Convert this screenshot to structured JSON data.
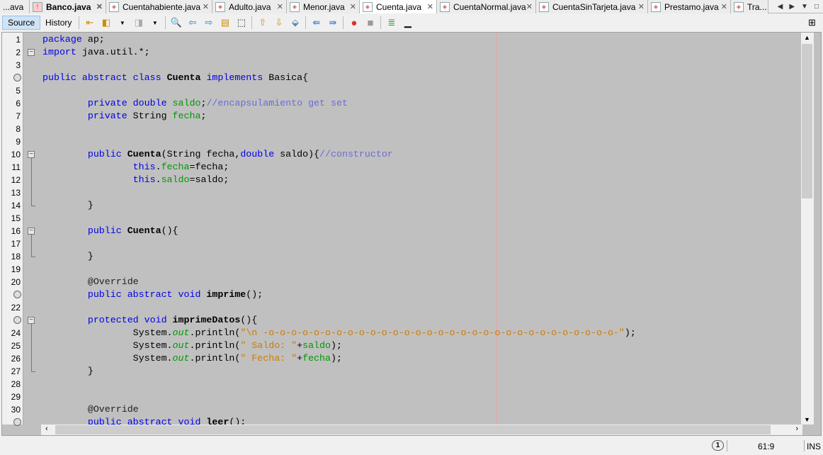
{
  "tabs": [
    {
      "label": "...ava",
      "active": false,
      "bold": false
    },
    {
      "label": "Banco.java",
      "active": false,
      "bold": true,
      "error": true
    },
    {
      "label": "Cuentahabiente.java",
      "active": false
    },
    {
      "label": "Adulto.java",
      "active": false
    },
    {
      "label": "Menor.java",
      "active": false
    },
    {
      "label": "Cuenta.java",
      "active": true
    },
    {
      "label": "CuentaNormal.java",
      "active": false
    },
    {
      "label": "CuentaSinTarjeta.java",
      "active": false
    },
    {
      "label": "Prestamo.java",
      "active": false
    },
    {
      "label": "Tra...",
      "active": false,
      "noclose": true
    }
  ],
  "toolbar": {
    "source_label": "Source",
    "history_label": "History"
  },
  "status": {
    "notifications": "1",
    "position": "61:9",
    "mode": "INS"
  },
  "code": [
    [
      [
        "package",
        "kw"
      ],
      [
        " ap;",
        "id"
      ]
    ],
    [
      [
        "import",
        "kw"
      ],
      [
        " java.util.*;",
        "id"
      ]
    ],
    [],
    [
      [
        "public abstract class",
        "kw"
      ],
      [
        " ",
        "id"
      ],
      [
        "Cuenta",
        "b"
      ],
      [
        " ",
        "id"
      ],
      [
        "implements",
        "kw"
      ],
      [
        " Basica{",
        "id"
      ]
    ],
    [],
    [
      [
        "        private double",
        "kw"
      ],
      [
        " ",
        "id"
      ],
      [
        "saldo",
        "fld"
      ],
      [
        ";",
        "id"
      ],
      [
        "//encapsulamiento get set",
        "cm"
      ]
    ],
    [
      [
        "        private",
        "kw"
      ],
      [
        " String ",
        "id"
      ],
      [
        "fecha",
        "fld"
      ],
      [
        ";",
        "id"
      ]
    ],
    [],
    [],
    [
      [
        "        public",
        "kw"
      ],
      [
        " ",
        "id"
      ],
      [
        "Cuenta",
        "b"
      ],
      [
        "(String fecha,",
        "id"
      ],
      [
        "double",
        "kw"
      ],
      [
        " saldo){",
        "id"
      ],
      [
        "//constructor",
        "cm"
      ]
    ],
    [
      [
        "                this",
        "kw"
      ],
      [
        ".",
        "id"
      ],
      [
        "fecha",
        "fld"
      ],
      [
        "=fecha;",
        "id"
      ]
    ],
    [
      [
        "                this",
        "kw"
      ],
      [
        ".",
        "id"
      ],
      [
        "saldo",
        "fld"
      ],
      [
        "=saldo;",
        "id"
      ]
    ],
    [],
    [
      [
        "        }",
        "id"
      ]
    ],
    [],
    [
      [
        "        public",
        "kw"
      ],
      [
        " ",
        "id"
      ],
      [
        "Cuenta",
        "b"
      ],
      [
        "(){",
        "id"
      ]
    ],
    [],
    [
      [
        "        }",
        "id"
      ]
    ],
    [],
    [
      [
        "        @Override",
        "ann"
      ]
    ],
    [
      [
        "        public abstract void",
        "kw"
      ],
      [
        " ",
        "id"
      ],
      [
        "imprime",
        "b"
      ],
      [
        "();",
        "id"
      ]
    ],
    [],
    [
      [
        "        protected void",
        "kw"
      ],
      [
        " ",
        "id"
      ],
      [
        "imprimeDatos",
        "b"
      ],
      [
        "(){",
        "id"
      ]
    ],
    [
      [
        "                System.",
        "id"
      ],
      [
        "out",
        "it"
      ],
      [
        ".println(",
        "id"
      ],
      [
        "\"\\n -o-o-o-o-o-o-o-o-o-o-o-o-o-o-o-o-o-o-o-o-o-o-o-o-o-o-o-o-o-o-o-\"",
        "str"
      ],
      [
        ");",
        "id"
      ]
    ],
    [
      [
        "                System.",
        "id"
      ],
      [
        "out",
        "it"
      ],
      [
        ".println(",
        "id"
      ],
      [
        "\" Saldo: \"",
        "str"
      ],
      [
        "+",
        "id"
      ],
      [
        "saldo",
        "fld"
      ],
      [
        ");",
        "id"
      ]
    ],
    [
      [
        "                System.",
        "id"
      ],
      [
        "out",
        "it"
      ],
      [
        ".println(",
        "id"
      ],
      [
        "\" Fecha: \"",
        "str"
      ],
      [
        "+",
        "id"
      ],
      [
        "fecha",
        "fld"
      ],
      [
        ");",
        "id"
      ]
    ],
    [
      [
        "        }",
        "id"
      ]
    ],
    [],
    [],
    [
      [
        "        @Override",
        "ann"
      ]
    ],
    [
      [
        "        public abstract void",
        "kw"
      ],
      [
        " ",
        "id"
      ],
      [
        "leer",
        "b"
      ],
      [
        "();",
        "id"
      ]
    ]
  ],
  "gutter_markers": {
    "4": "implements-icon",
    "21": "override-icon",
    "23": "overridden-icon",
    "31": "override-icon"
  },
  "folds": [
    2,
    10,
    16,
    23
  ]
}
